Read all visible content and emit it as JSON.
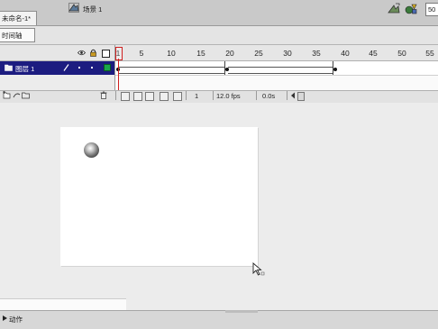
{
  "document": {
    "tab_title": "未命名-1*"
  },
  "edit_bar": {
    "timeline_toggle_label": "时间轴",
    "scene_label": "场景 1",
    "zoom_value": "50"
  },
  "timeline": {
    "frame_numbers": [
      "1",
      "5",
      "10",
      "15",
      "20",
      "25",
      "30",
      "35",
      "40",
      "45",
      "50",
      "55"
    ],
    "layers": [
      {
        "name": "图层 1",
        "selected": true,
        "color": "#1aa84a"
      }
    ],
    "current_frame": "1",
    "frame_rate": "12.0 fps",
    "elapsed_time": "0.0s",
    "keyframes": [
      1,
      20,
      39
    ],
    "tween_spans": [
      [
        1,
        20
      ],
      [
        20,
        39
      ]
    ]
  },
  "panels": {
    "actions_label": "动作"
  },
  "colors": {
    "selected_layer": "#1c1c80",
    "playhead": "#d02020",
    "stage": "#ffffff"
  },
  "icons": [
    "eye-icon",
    "lock-icon",
    "outline-icon",
    "layer-icon",
    "pencil-icon",
    "trash-icon",
    "scene-icon",
    "edit-scene-icon",
    "edit-symbol-icon",
    "cursor-icon"
  ]
}
